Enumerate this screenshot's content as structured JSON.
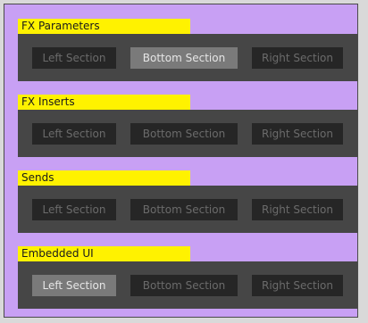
{
  "groups": [
    {
      "title": "FX Parameters",
      "buttons": [
        {
          "label": "Left Section",
          "active": false
        },
        {
          "label": "Bottom Section",
          "active": true
        },
        {
          "label": "Right Section",
          "active": false
        }
      ]
    },
    {
      "title": "FX Inserts",
      "buttons": [
        {
          "label": "Left Section",
          "active": false
        },
        {
          "label": "Bottom Section",
          "active": false
        },
        {
          "label": "Right Section",
          "active": false
        }
      ]
    },
    {
      "title": "Sends",
      "buttons": [
        {
          "label": "Left Section",
          "active": false
        },
        {
          "label": "Bottom Section",
          "active": false
        },
        {
          "label": "Right Section",
          "active": false
        }
      ]
    },
    {
      "title": "Embedded UI",
      "buttons": [
        {
          "label": "Left Section",
          "active": true
        },
        {
          "label": "Bottom Section",
          "active": false
        },
        {
          "label": "Right Section",
          "active": false
        }
      ]
    }
  ],
  "colors": {
    "background": "#c8a0f4",
    "header": "#fff200",
    "panel": "#464646",
    "button": "#262626",
    "button_active": "#7a7a7a"
  }
}
